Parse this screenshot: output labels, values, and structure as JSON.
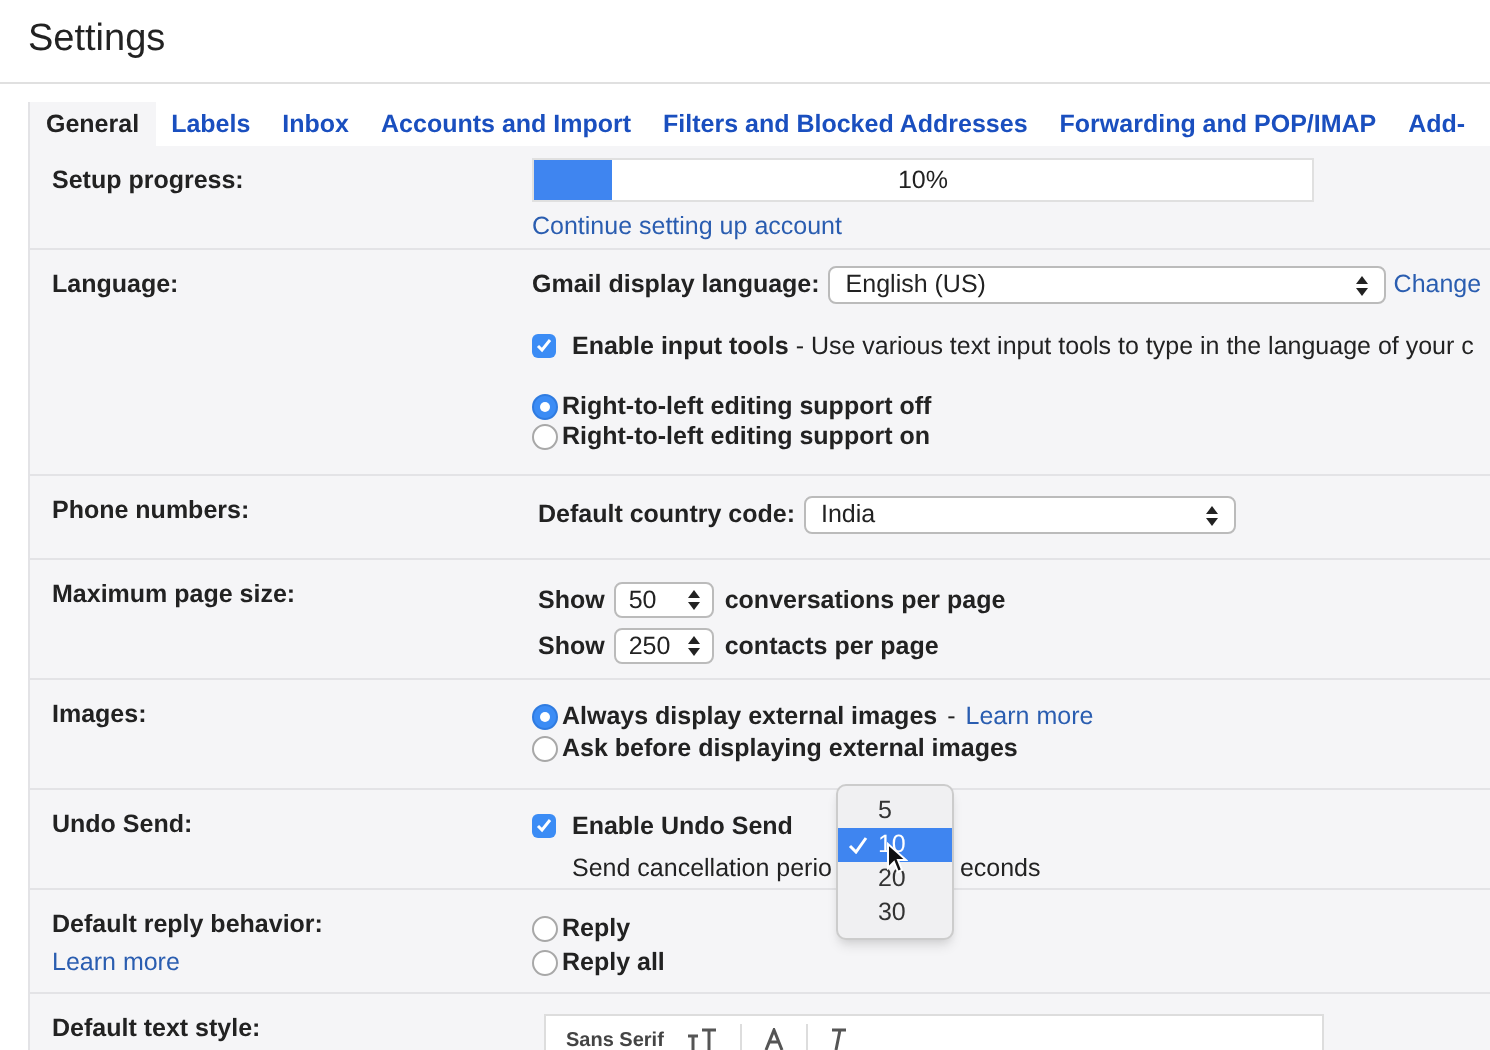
{
  "page_title": "Settings",
  "tabs": [
    {
      "label": "General",
      "selected": true
    },
    {
      "label": "Labels",
      "selected": false
    },
    {
      "label": "Inbox",
      "selected": false
    },
    {
      "label": "Accounts and Import",
      "selected": false
    },
    {
      "label": "Filters and Blocked Addresses",
      "selected": false
    },
    {
      "label": "Forwarding and POP/IMAP",
      "selected": false
    },
    {
      "label": "Add-",
      "selected": false
    }
  ],
  "setup_progress": {
    "label": "Setup progress:",
    "level": 0.1,
    "reading": "10%",
    "link": "Continue setting up account"
  },
  "language": {
    "label": "Language:",
    "display_language_label": "Gmail display language:",
    "display_language_value": "English (US)",
    "change_link": "Change",
    "input_tools": {
      "checked": true,
      "text": "**Enable input tools** - Use various text input tools to type in the language of your c"
    },
    "rtl_options": [
      {
        "label": "Right-to-left editing support off",
        "selected": true
      },
      {
        "label": "Right-to-left editing support on",
        "selected": false
      }
    ]
  },
  "phone_numbers": {
    "label": "Phone numbers:",
    "field_label": "Default country code:",
    "value": "India"
  },
  "page_size": {
    "label": "Maximum page size:",
    "rows": [
      {
        "prefix": "Show",
        "value": "50",
        "suffix": "conversations per page"
      },
      {
        "prefix": "Show",
        "value": "250",
        "suffix": "contacts per page"
      }
    ]
  },
  "images": {
    "label": "Images:",
    "options": [
      {
        "label": "Always display external images",
        "selected": true,
        "separator": "-",
        "link": "Learn more"
      },
      {
        "label": "Ask before displaying external images",
        "selected": false
      }
    ]
  },
  "undo_send": {
    "label": "Undo Send:",
    "checkbox": {
      "checked": true,
      "label": "Enable Undo Send"
    },
    "period_before": "Send cancellation perio",
    "period_after": "econds",
    "dropdown": [
      {
        "label": "5",
        "selected": false
      },
      {
        "label": "10",
        "selected": true
      },
      {
        "label": "20",
        "selected": false
      },
      {
        "label": "30",
        "selected": false
      }
    ]
  },
  "reply_behavior": {
    "label": "Default reply behavior:",
    "link": "Learn more",
    "options": [
      {
        "label": "Reply",
        "selected": false
      },
      {
        "label": "Reply all",
        "selected": false
      }
    ]
  },
  "text_style": {
    "label": "Default text style:",
    "font": "Sans Serif"
  }
}
